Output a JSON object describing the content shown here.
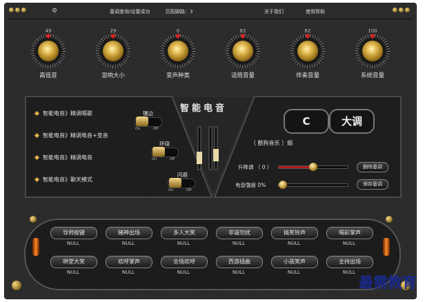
{
  "header": {
    "icon": "gear-icon",
    "status": "基调查询/设置成功",
    "script_label": "匹配脚路：",
    "script_value": "3",
    "about": "关于我们",
    "help": "使用帮助"
  },
  "knobs": [
    {
      "label": "高低音",
      "value": "49"
    },
    {
      "label": "混响大小",
      "value": "29"
    },
    {
      "label": "变声种类",
      "value": "0"
    },
    {
      "label": "话筒音量",
      "value": "82"
    },
    {
      "label": "伴奏音量",
      "value": "62"
    },
    {
      "label": "系统音量",
      "value": "100"
    }
  ],
  "modes": [
    "智能电音》精调唱歌",
    "智能电音》精调电音+变音",
    "智能电音》精调电音",
    "智能电音》聊天模式"
  ],
  "toggles": [
    {
      "label": "镶边",
      "on": "On",
      "off": "Off",
      "state": "on"
    },
    {
      "label": "环绕",
      "on": "On",
      "off": "Off",
      "state": "on"
    },
    {
      "label": "闪避",
      "on": "On",
      "off": "Off",
      "state": "on"
    }
  ],
  "logo_text": "智能电音",
  "key": {
    "note": "C",
    "scale": "大调"
  },
  "song": "（ 酷狗音乐 ）烟",
  "pitch": {
    "label": "升降调",
    "value": "（ 0 ）",
    "fraction": 0.5
  },
  "strength": {
    "label": "电音强度",
    "value": "0%",
    "fraction": 0.0
  },
  "buttons": {
    "delete": "删除基调",
    "save": "保存基调"
  },
  "effects": [
    {
      "label": "导师按键",
      "sub": "NULL"
    },
    {
      "label": "赌神出场",
      "sub": "NULL"
    },
    {
      "label": "多人大笑",
      "sub": "NULL"
    },
    {
      "label": "非诚勿扰",
      "sub": "NULL"
    },
    {
      "label": "搞笑铃声",
      "sub": "NULL"
    },
    {
      "label": "喝彩掌声",
      "sub": "NULL"
    },
    {
      "label": "哄堂大笑",
      "sub": "NULL"
    },
    {
      "label": "欢呼掌声",
      "sub": "NULL"
    },
    {
      "label": "全场欢呼",
      "sub": "NULL"
    },
    {
      "label": "西游插曲",
      "sub": "NULL"
    },
    {
      "label": "小孩笑声",
      "sub": "NULL"
    },
    {
      "label": "主持出场",
      "sub": "NULL"
    }
  ],
  "watermark": "最需教育",
  "colors": {
    "accent_gold": "#e2b24a",
    "indicator_red": "#e02020",
    "watermark_blue": "#1a2a8a"
  }
}
